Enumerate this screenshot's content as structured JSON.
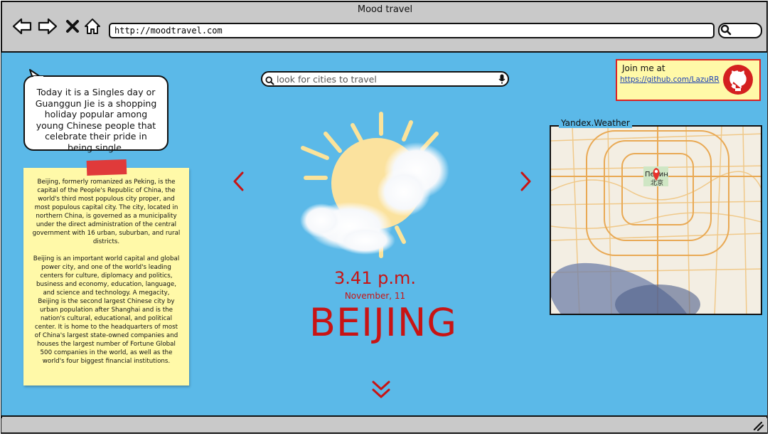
{
  "window": {
    "title": "Mood travel"
  },
  "browser": {
    "url": "http://moodtravel.com"
  },
  "search": {
    "placeholder": "look for cities to travel"
  },
  "fact_bubble": {
    "text": "Today it is a Singles day or Guanggun Jie is a shopping holiday popular among young Chinese people that celebrate their pride in being single."
  },
  "note": {
    "paragraphs": [
      "Beijing, formerly romanized as Peking, is the capital of the People's Republic of China, the world's third most populous city proper, and most populous capital city. The city, located in northern China, is governed as a municipality under the direct administration of the central government with 16 urban, suburban, and rural districts.",
      "Beijing is an important world capital and global power city, and one of the world's leading centers for culture, diplomacy and politics, business and economy, education, language, and science and technology. A megacity, Beijing is the second largest Chinese city by urban population after Shanghai and is the nation's cultural, educational, and political center. It is home to the headquarters of most of China's largest state-owned companies and houses the largest number of Fortune Global 500 companies in the world, as well as the world's four biggest financial institutions."
    ]
  },
  "weather": {
    "time": "3.41 p.m.",
    "date": "November, 11",
    "city": "BEIJING",
    "icon": "sun-behind-cloud-icon"
  },
  "join": {
    "text": "Join me at",
    "link": "https://github.com/LazuRR"
  },
  "map": {
    "label": "Yandex.Weather",
    "city_label_ru": "Пекин",
    "city_label_zh": "北京"
  },
  "colors": {
    "background": "#5bb9e8",
    "accent": "#c81414",
    "note": "#fff9a8"
  }
}
